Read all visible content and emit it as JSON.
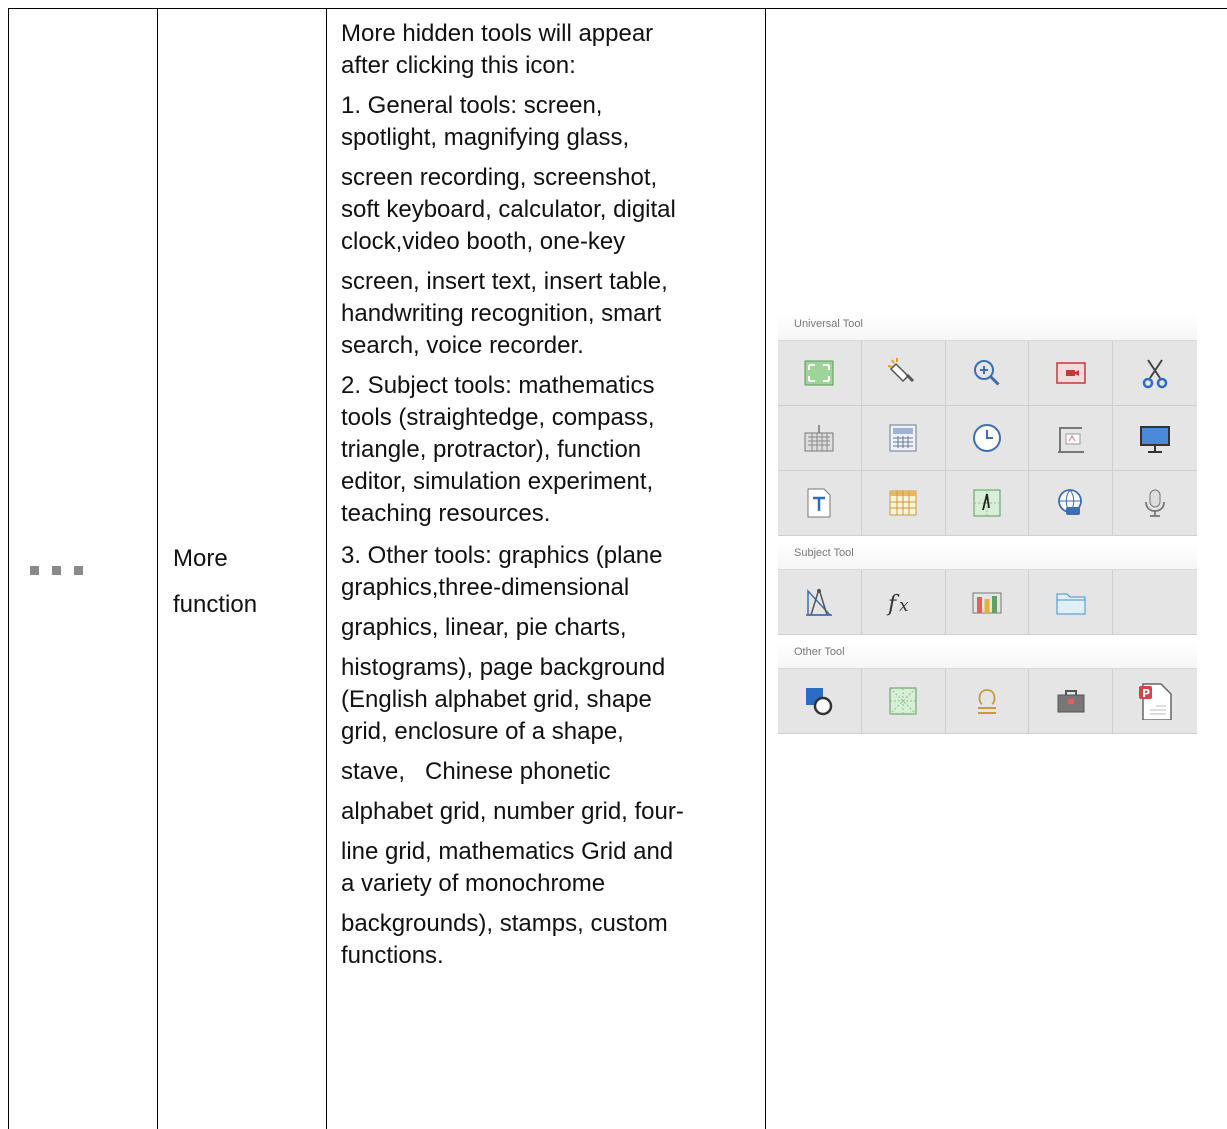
{
  "row": {
    "icon": "ellipsis-icon",
    "function_label": {
      "line1": "More",
      "line2": "function"
    },
    "description": {
      "intro": [
        "More hidden tools will appear",
        "after clicking this icon:"
      ],
      "general": [
        "1. General tools: screen,",
        "spotlight, magnifying glass,",
        "screen recording, screenshot,",
        "soft keyboard, calculator, digital",
        "clock,video booth, one-key",
        "screen, insert text, insert table,",
        "handwriting recognition, smart",
        "search, voice recorder."
      ],
      "subject": [
        "2. Subject tools: mathematics",
        "tools (straightedge, compass,",
        "triangle, protractor), function",
        "editor, simulation experiment,",
        "teaching resources."
      ],
      "other": [
        "3. Other tools: graphics (plane",
        "graphics,three-dimensional",
        "graphics, linear, pie charts,",
        "histograms), page background",
        "(English alphabet grid, shape",
        "grid, enclosure of a shape,",
        "stave,   Chinese phonetic",
        "alphabet grid, number grid, four-",
        "line grid, mathematics Grid and",
        "a variety of monochrome",
        "backgrounds), stamps, custom",
        "functions."
      ]
    }
  },
  "tool_panel": {
    "universal_title": "Universal Tool",
    "subject_title": "Subject Tool",
    "other_title": "Other Tool",
    "universal_icons": [
      "screen-icon",
      "spotlight-icon",
      "magnifier-icon",
      "screen-record-icon",
      "scissors-icon",
      "keyboard-icon",
      "calculator-icon",
      "clock-icon",
      "video-booth-icon",
      "one-key-screen-icon",
      "insert-text-icon",
      "insert-table-icon",
      "handwriting-icon",
      "smart-search-icon",
      "voice-recorder-icon"
    ],
    "subject_icons": [
      "math-tools-icon",
      "function-editor-icon",
      "experiment-icon",
      "teaching-resources-icon"
    ],
    "other_icons": [
      "graphics-icon",
      "page-background-icon",
      "stamp-icon",
      "toolbox-icon",
      "custom-function-icon"
    ]
  }
}
